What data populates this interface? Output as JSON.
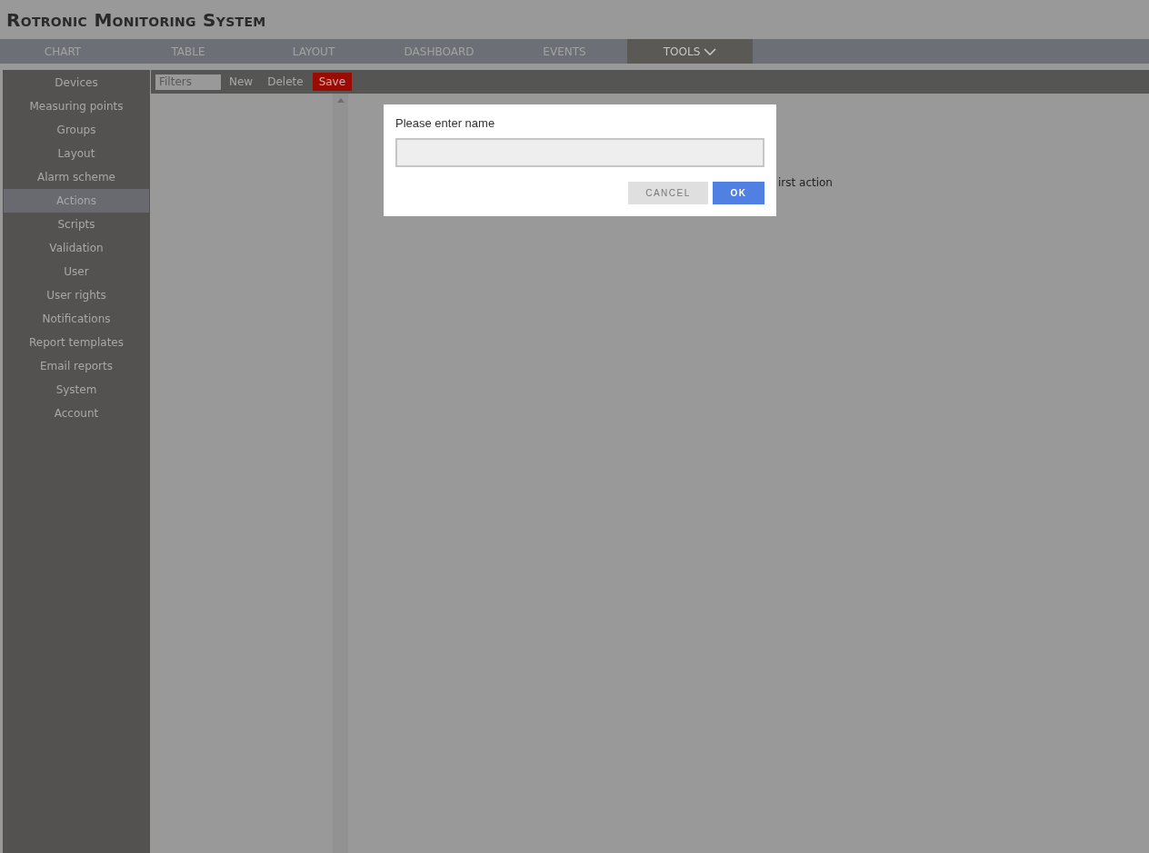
{
  "app_title": "Rotronic Monitoring System",
  "tabs": [
    {
      "label": "CHART",
      "selected": false
    },
    {
      "label": "TABLE",
      "selected": false
    },
    {
      "label": "LAYOUT",
      "selected": false
    },
    {
      "label": "DASHBOARD",
      "selected": false
    },
    {
      "label": "EVENTS",
      "selected": false
    },
    {
      "label": "TOOLS",
      "selected": true,
      "kind": "dropdown"
    }
  ],
  "sidebar": {
    "items": [
      {
        "label": "Devices",
        "selected": false
      },
      {
        "label": "Measuring points",
        "selected": false
      },
      {
        "label": "Groups",
        "selected": false
      },
      {
        "label": "Layout",
        "selected": false
      },
      {
        "label": "Alarm scheme",
        "selected": false
      },
      {
        "label": "Actions",
        "selected": true
      },
      {
        "label": "Scripts",
        "selected": false
      },
      {
        "label": "Validation",
        "selected": false
      },
      {
        "label": "User",
        "selected": false
      },
      {
        "label": "User rights",
        "selected": false
      },
      {
        "label": "Notifications",
        "selected": false
      },
      {
        "label": "Report templates",
        "selected": false
      },
      {
        "label": "Email reports",
        "selected": false
      },
      {
        "label": "System",
        "selected": false
      },
      {
        "label": "Account",
        "selected": false
      }
    ]
  },
  "toolbar": {
    "filter": {
      "placeholder": "Filters"
    },
    "buttons": [
      {
        "label": "New",
        "kind": "plain"
      },
      {
        "label": "Delete",
        "kind": "plain"
      },
      {
        "label": "Save",
        "kind": "primary"
      }
    ]
  },
  "content": {
    "hint": "irst action"
  },
  "dialog": {
    "title": "Please enter name",
    "buttons": [
      {
        "label": "CANCEL",
        "kind": "cancel"
      },
      {
        "label": "OK",
        "kind": "ok"
      }
    ]
  }
}
